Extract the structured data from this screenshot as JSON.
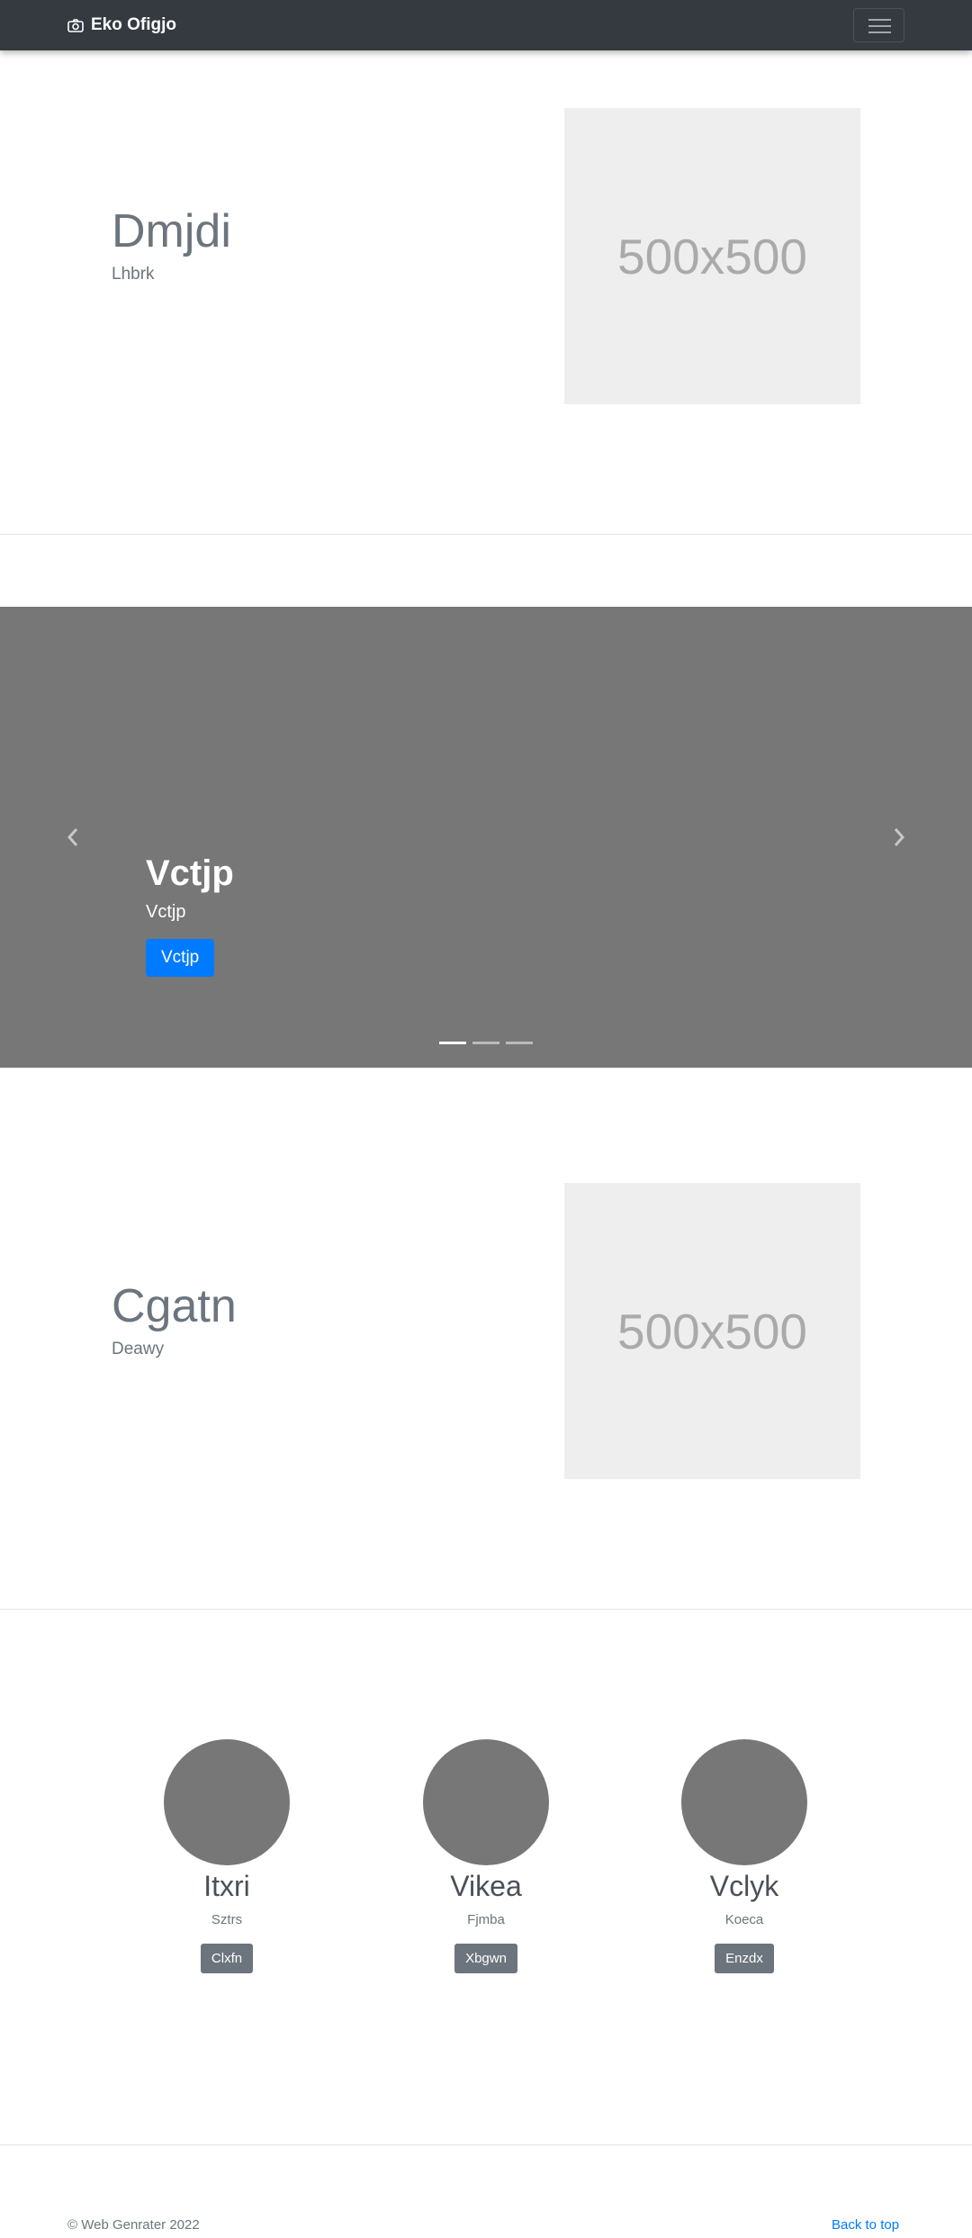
{
  "navbar": {
    "brand": "Eko Ofigjo",
    "brand_icon": "camera-icon"
  },
  "feature1": {
    "title": "Dmjdi",
    "subtitle": "Lhbrk",
    "image_label": "500x500"
  },
  "carousel": {
    "title": "Vctjp",
    "subtitle": "Vctjp",
    "button": "Vctjp",
    "slide_count": 3,
    "active_slide": 1,
    "background": "#777777",
    "button_color": "#007bff"
  },
  "feature2": {
    "title": "Cgatn",
    "subtitle": "Deawy",
    "image_label": "500x500"
  },
  "people": [
    {
      "name": "Itxri",
      "subtitle": "Sztrs",
      "button": "Clxfn"
    },
    {
      "name": "Vikea",
      "subtitle": "Fjmba",
      "button": "Xbgwn"
    },
    {
      "name": "Vclyk",
      "subtitle": "Koeca",
      "button": "Enzdx"
    }
  ],
  "footer": {
    "copyright": "© Web Genrater 2022",
    "back_to_top": "Back to top"
  }
}
